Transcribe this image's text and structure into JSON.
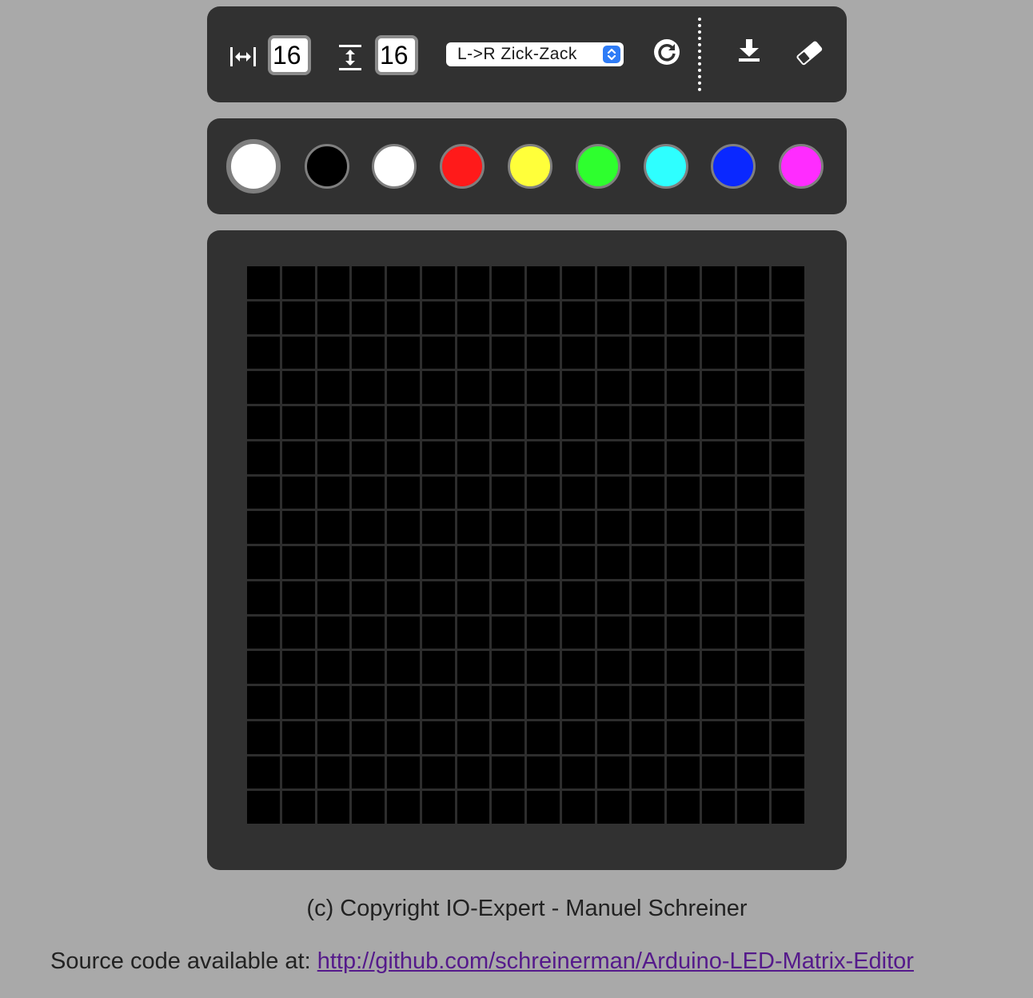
{
  "toolbar": {
    "width_value": "16",
    "height_value": "16",
    "wiring_mode": "L->R Zick-Zack",
    "icons": [
      "width-icon",
      "height-icon",
      "refresh-icon",
      "download-icon",
      "eraser-icon"
    ]
  },
  "palette": {
    "current_color": "#ffffff",
    "swatches": [
      "#000000",
      "#ffffff",
      "#ff1a1a",
      "#ffff3a",
      "#2eff2e",
      "#2effff",
      "#0a28ff",
      "#ff2cff"
    ]
  },
  "matrix": {
    "cols": 16,
    "rows": 16,
    "cell_color": "#000000",
    "grid_line_color": "#2d2d2d"
  },
  "footer": {
    "copyright": "(c) Copyright IO-Expert - Manuel Schreiner",
    "source_prefix": "Source code available at: ",
    "source_link": "http://github.com/schreinerman/Arduino-LED-Matrix-Editor"
  }
}
